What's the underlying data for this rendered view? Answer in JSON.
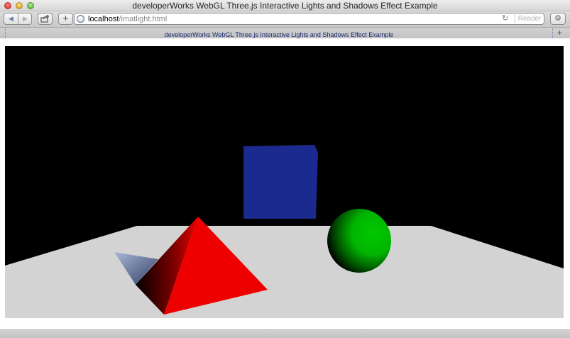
{
  "window": {
    "title": "developerWorks WebGL Three.js Interactive Lights and Shadows Effect Example"
  },
  "toolbar": {
    "back_icon": "back-arrow-icon",
    "forward_icon": "forward-arrow-icon",
    "share_icon": "share-icon",
    "add_label": "+",
    "url_host": "localhost",
    "url_path": "/imatlight.html",
    "reload_icon": "reload-icon",
    "reader_label": "Reader",
    "settings_icon": "gear-icon"
  },
  "tabs": [
    {
      "label": "developerWorks WebGL Three.js Interactive Lights and Shadows Effect Example"
    }
  ],
  "new_tab_label": "+",
  "scene": {
    "background_color": "#000000",
    "floor_color": "#d3d3d3",
    "cube_color": "#1a2a8e",
    "pyramid_color": "#ee0000",
    "sphere_color": "#00bb00",
    "objects": [
      "floor",
      "cube",
      "pyramid",
      "sphere",
      "shadow"
    ]
  }
}
